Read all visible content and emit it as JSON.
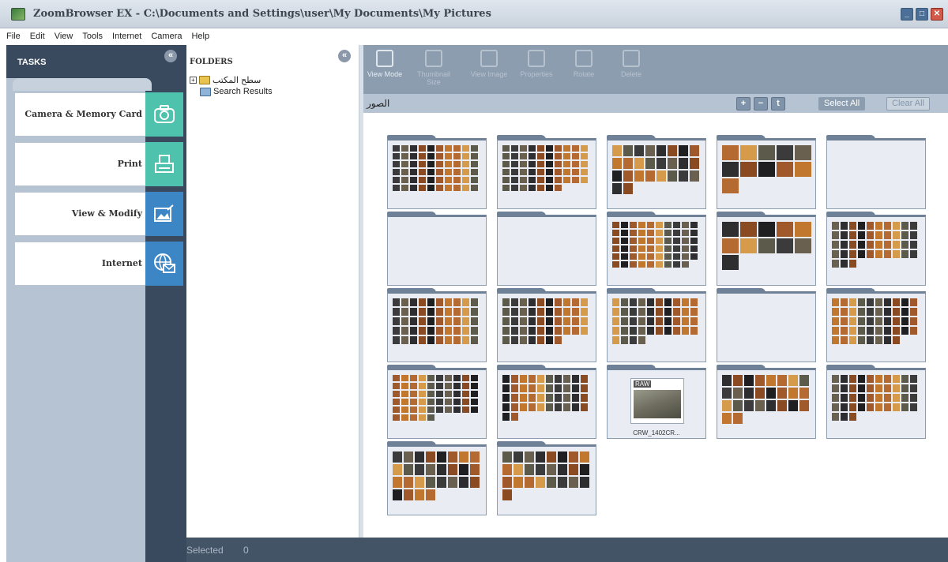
{
  "window": {
    "title": "ZoomBrowser EX  -  C:\\Documents and Settings\\user\\My Documents\\My Pictures",
    "buttons": [
      "minimize",
      "maximize",
      "close"
    ]
  },
  "menu": [
    "File",
    "Edit",
    "View",
    "Tools",
    "Internet",
    "Camera",
    "Help"
  ],
  "tasks": {
    "header": "TASKS",
    "items": [
      {
        "label": "Camera & Memory Card",
        "icon": "camera-icon",
        "color": "#4fc2ad"
      },
      {
        "label": "Print",
        "icon": "print-icon",
        "color": "#4fc2ad"
      },
      {
        "label": "View & Modify",
        "icon": "view-modify-icon",
        "color": "#3c86c6"
      },
      {
        "label": "Internet",
        "icon": "internet-icon",
        "color": "#3c86c6"
      }
    ]
  },
  "folders": {
    "header": "FOLDERS",
    "tree": [
      {
        "label": "سطح المكتب",
        "expander": "+"
      },
      {
        "label": "Search Results"
      }
    ]
  },
  "toolbar": {
    "items": [
      {
        "label": "View Mode",
        "enabled": true
      },
      {
        "label": "Thumbnail Size",
        "enabled": false
      },
      {
        "label": "View Image",
        "enabled": false
      },
      {
        "label": "Properties",
        "enabled": false
      },
      {
        "label": "Rotate",
        "enabled": false
      },
      {
        "label": "Delete",
        "enabled": false
      }
    ]
  },
  "pathbar": {
    "path": "الصور",
    "select_all": "Select All",
    "clear_all": "Clear All"
  },
  "grid": {
    "folders": [
      {
        "content": "thumbs",
        "rows": 6
      },
      {
        "content": "thumbs",
        "rows": 6
      },
      {
        "content": "thumbs",
        "rows": 4
      },
      {
        "content": "thumbs",
        "rows": 3
      },
      {
        "content": "empty"
      },
      {
        "content": "empty"
      },
      {
        "content": "empty"
      },
      {
        "content": "thumbs",
        "rows": 6
      },
      {
        "content": "thumbs",
        "rows": 3
      },
      {
        "content": "thumbs",
        "rows": 5
      },
      {
        "content": "thumbs",
        "rows": 5
      },
      {
        "content": "thumbs",
        "rows": 5
      },
      {
        "content": "thumbs",
        "rows": 5
      },
      {
        "content": "empty"
      },
      {
        "content": "thumbs",
        "rows": 5
      },
      {
        "content": "thumbs",
        "rows": 6
      },
      {
        "content": "thumbs",
        "rows": 5
      },
      {
        "content": "photo",
        "caption": "CRW_1402CR...",
        "tag": "RAW"
      },
      {
        "content": "thumbs",
        "rows": 4
      },
      {
        "content": "thumbs",
        "rows": 5
      },
      {
        "content": "thumbs",
        "rows": 4
      },
      {
        "content": "thumbs",
        "rows": 4
      }
    ]
  },
  "status": {
    "label": "Selected",
    "count": "0"
  }
}
